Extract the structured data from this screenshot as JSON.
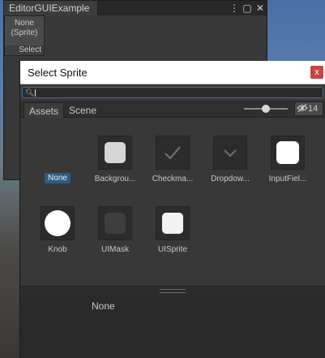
{
  "editor": {
    "tab_title": "EditorGUIExample",
    "controls": [
      "⋮",
      "▢",
      "✕"
    ],
    "sprite_field": {
      "value": "None\n(Sprite)",
      "select_label": "Select"
    }
  },
  "dialog": {
    "title": "Select Sprite",
    "close_label": "x",
    "search": {
      "value": "",
      "placeholder": ""
    },
    "tabs": [
      {
        "label": "Assets",
        "active": true
      },
      {
        "label": "Scene",
        "active": false
      }
    ],
    "zoom_fraction": 0.5,
    "hidden_count": "14",
    "items": [
      {
        "label": "None",
        "kind": "none",
        "selected": true
      },
      {
        "label": "Backgrou...",
        "kind": "rounded-light"
      },
      {
        "label": "Checkma...",
        "kind": "checkmark"
      },
      {
        "label": "Dropdow...",
        "kind": "chevron"
      },
      {
        "label": "InputFiel...",
        "kind": "rounded-white"
      },
      {
        "label": "Knob",
        "kind": "circle-white"
      },
      {
        "label": "UIMask",
        "kind": "rounded-dark"
      },
      {
        "label": "UISprite",
        "kind": "rounded-white-small"
      }
    ],
    "preview_text": "None"
  }
}
